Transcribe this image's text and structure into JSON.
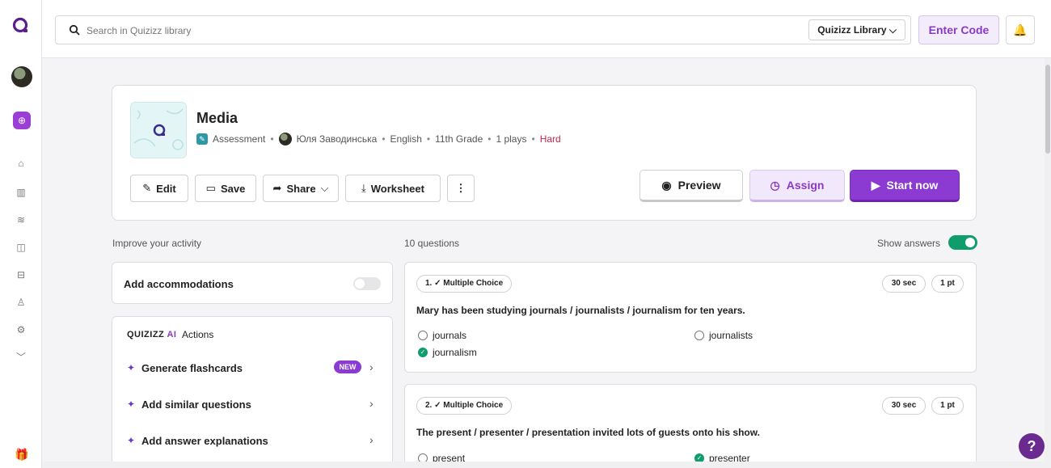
{
  "colors": {
    "brand": "#8b3bd1",
    "correct": "#0f9d6b",
    "hard": "#c0264a"
  },
  "rail": {
    "icons": [
      "quizizz-logo-icon",
      "avatar",
      "create-icon",
      "explore-icon",
      "library-icon",
      "reports-icon",
      "classes-icon",
      "settings-icon",
      "profile-icon",
      "more-icon",
      "gift-icon"
    ]
  },
  "topbar": {
    "search_placeholder": "Search in Quizizz library",
    "library_select": "Quizizz Library",
    "enter_code": "Enter Code"
  },
  "quiz": {
    "title": "Media",
    "type": "Assessment",
    "author": "Юля Заводинська",
    "subject": "English",
    "grade": "11th Grade",
    "plays": "1 plays",
    "difficulty": "Hard",
    "buttons": {
      "edit": "Edit",
      "save": "Save",
      "share": "Share",
      "worksheet": "Worksheet",
      "preview": "Preview",
      "assign": "Assign",
      "start": "Start now"
    }
  },
  "left": {
    "heading": "Improve your activity",
    "accommodations": "Add accommodations",
    "ai_brand_prefix": "QUIZIZZ",
    "ai_brand_suffix": "AI",
    "ai_actions": "Actions",
    "items": [
      {
        "label": "Generate flashcards",
        "badge": "NEW"
      },
      {
        "label": "Add similar questions"
      },
      {
        "label": "Add answer explanations"
      }
    ]
  },
  "questions": {
    "count_label": "10 questions",
    "show_answers": "Show answers",
    "show_answers_on": true,
    "items": [
      {
        "type": "1. ✓ Multiple Choice",
        "time": "30 sec",
        "points": "1 pt",
        "text": "Mary has been studying journals / journalists / journalism for ten years.",
        "options": [
          {
            "text": "journals",
            "correct": false
          },
          {
            "text": "journalists",
            "correct": false
          },
          {
            "text": "journalism",
            "correct": true
          }
        ]
      },
      {
        "type": "2. ✓ Multiple Choice",
        "time": "30 sec",
        "points": "1 pt",
        "text": "The present / presenter / presentation invited lots of guests onto his show.",
        "options": [
          {
            "text": "present",
            "correct": false
          },
          {
            "text": "presenter",
            "correct": true
          }
        ]
      }
    ]
  },
  "help_label": "?"
}
